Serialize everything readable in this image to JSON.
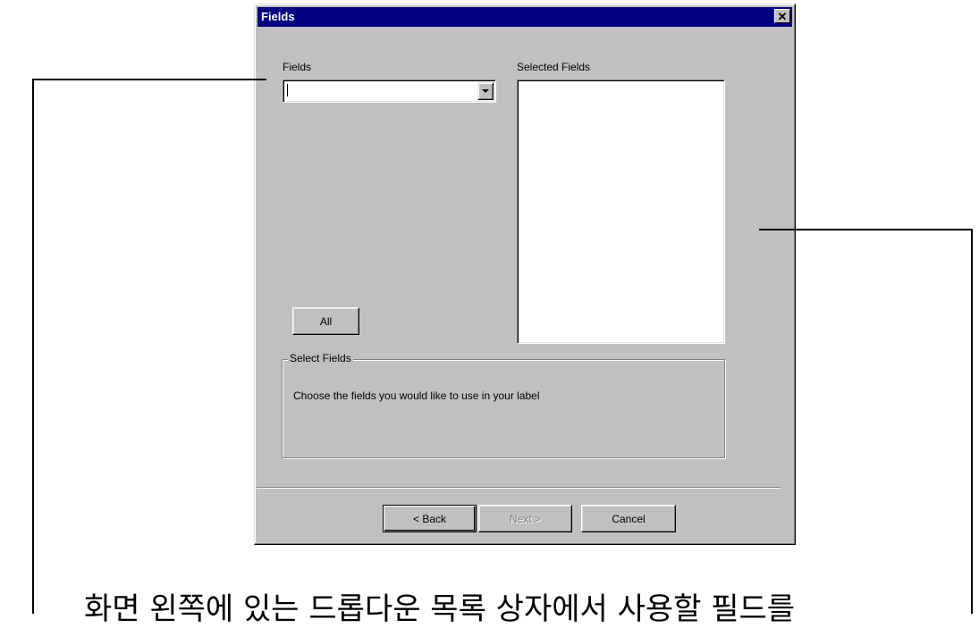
{
  "dialog": {
    "title": "Fields",
    "fields_label": "Fields",
    "fields_value": "",
    "selected_fields_label": "Selected Fields",
    "all_button": "All",
    "group_title": "Select Fields",
    "group_text": "Choose the fields you would like to use in your label",
    "back_button": "< Back",
    "next_button": "Next >",
    "cancel_button": "Cancel"
  },
  "annotation": {
    "caption": "화면 왼쪽에 있는 드롭다운 목록 상자에서 사용할 필드를"
  }
}
